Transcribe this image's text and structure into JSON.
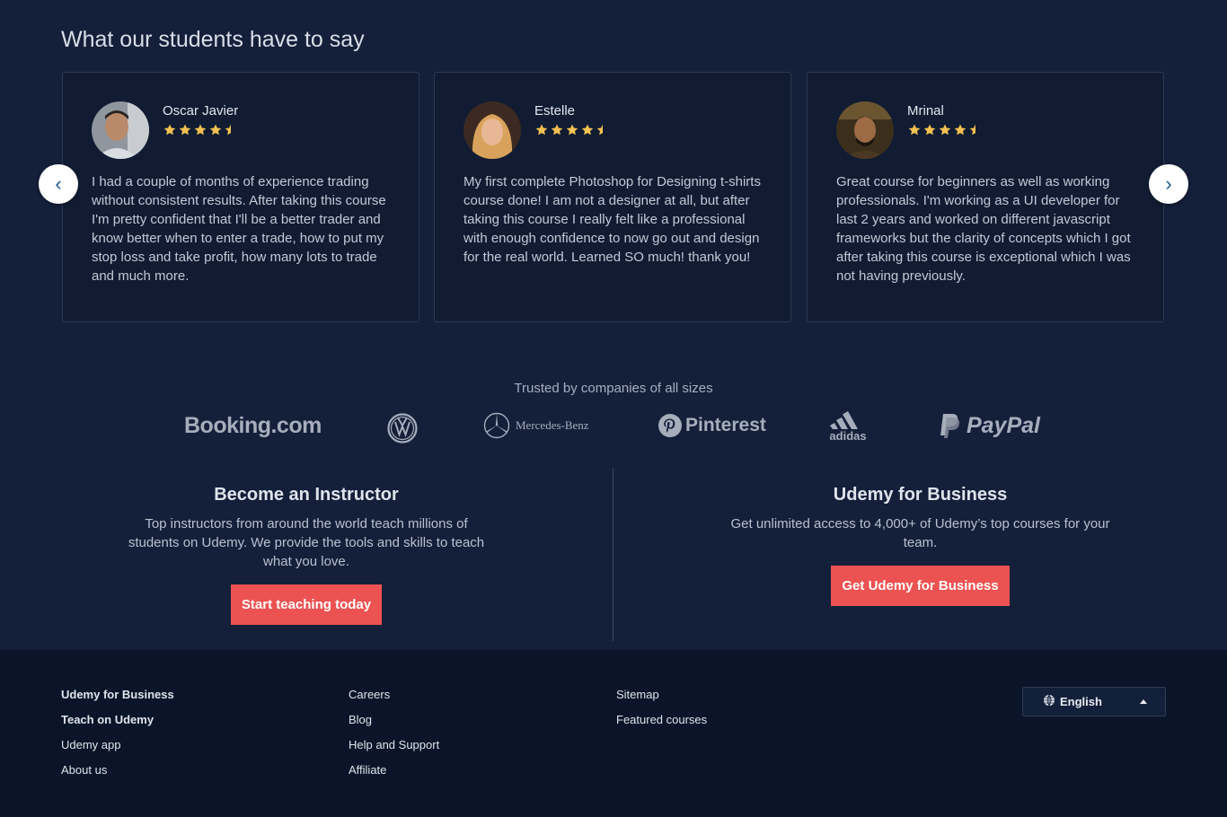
{
  "testimonials": {
    "title": "What our students have to say",
    "prev_label": "‹",
    "next_label": "›",
    "rating": 4.5,
    "star_color": "#f4c150",
    "items": [
      {
        "name": "Oscar Javier",
        "rating": 4.5,
        "quote": "I had a couple of months of experience trading without consistent results. After taking this course I'm pretty confident that I'll be a better trader and know better when to enter a trade, how to put my stop loss and take profit, how many lots to trade and much more."
      },
      {
        "name": "Estelle",
        "rating": 4.5,
        "quote": "My first complete Photoshop for Designing t-shirts course done! I am not a designer at all, but after taking this course I really felt like a professional with enough confidence to now go out and design for the real world. Learned SO much! thank you!"
      },
      {
        "name": "Mrinal",
        "rating": 4.5,
        "quote": "Great course for beginners as well as working professionals. I'm working as a UI developer for last 2 years and worked on different javascript frameworks but the clarity of concepts which I got after taking this course is exceptional which I was not having previously."
      }
    ]
  },
  "trusted": {
    "title": "Trusted by companies of all sizes",
    "logos": {
      "booking": "Booking.com",
      "vw": "",
      "mercedes": "Mercedes-Benz",
      "pinterest": "Pinterest",
      "adidas": "adidas",
      "paypal": "PayPal"
    }
  },
  "cta": {
    "instructor": {
      "title": "Become an Instructor",
      "text": "Top instructors from around the world teach millions of students on Udemy. We provide the tools and skills to teach what you love.",
      "button": "Start teaching today"
    },
    "business": {
      "title": "Udemy for Business",
      "text": "Get unlimited access to 4,000+ of Udemy’s top courses for your team.",
      "button": "Get Udemy for Business"
    },
    "button_color": "#ec5252"
  },
  "footer": {
    "col1": [
      "Udemy for Business",
      "Teach on Udemy",
      "Udemy app",
      "About us"
    ],
    "col2": [
      "Careers",
      "Blog",
      "Help and Support",
      "Affiliate"
    ],
    "col3": [
      "Sitemap",
      "Featured courses"
    ],
    "language": "English"
  }
}
